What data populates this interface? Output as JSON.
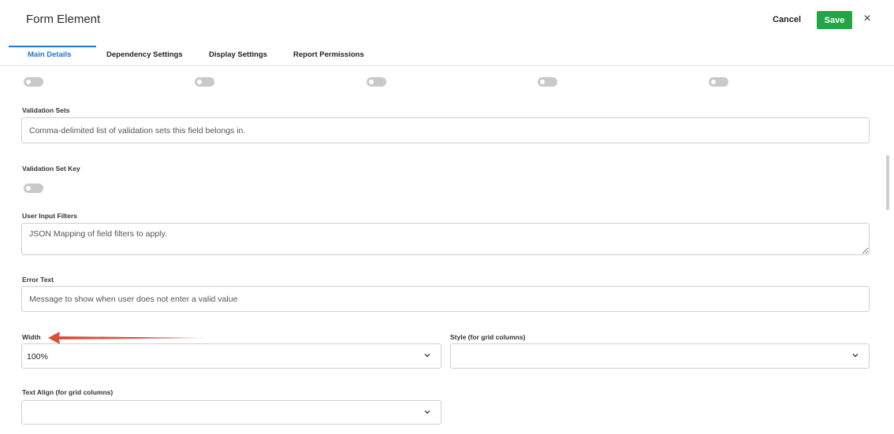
{
  "header": {
    "title": "Form Element",
    "cancel_label": "Cancel",
    "save_label": "Save",
    "close_icon": "×"
  },
  "tabs": [
    {
      "label": "Main Details",
      "active": true
    },
    {
      "label": "Dependency Settings",
      "active": false
    },
    {
      "label": "Display Settings",
      "active": false
    },
    {
      "label": "Report Permissions",
      "active": false
    }
  ],
  "form": {
    "top_toggles": [
      false,
      false,
      false,
      false,
      false
    ],
    "validation_sets": {
      "label": "Validation Sets",
      "placeholder": "Comma-delimited list of validation sets this field belongs in.",
      "value": ""
    },
    "validation_set_key": {
      "label": "Validation Set Key",
      "enabled": false
    },
    "user_input_filters": {
      "label": "User Input Filters",
      "placeholder": "JSON Mapping of field filters to apply.",
      "value": ""
    },
    "error_text": {
      "label": "Error Text",
      "placeholder": "Message to show when user does not enter a valid value",
      "value": ""
    },
    "width": {
      "label": "Width",
      "value": "100%"
    },
    "style": {
      "label": "Style (for grid columns)",
      "value": ""
    },
    "text_align": {
      "label": "Text Align (for grid columns)",
      "value": ""
    }
  },
  "colors": {
    "accent": "#1f77c9",
    "save": "#22a447",
    "annotation_arrow": "#d9503c"
  }
}
